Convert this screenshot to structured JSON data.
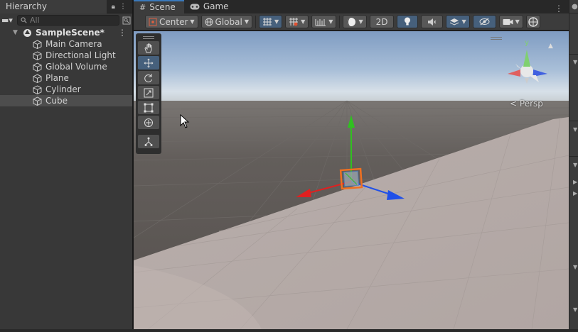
{
  "hierarchy": {
    "tab_label": "Hierarchy",
    "search_placeholder": "All",
    "scene_name": "SampleScene*",
    "items": [
      {
        "label": "Main Camera"
      },
      {
        "label": "Directional Light"
      },
      {
        "label": "Global Volume"
      },
      {
        "label": "Plane"
      },
      {
        "label": "Cylinder"
      },
      {
        "label": "Cube",
        "selected": true
      }
    ]
  },
  "scene_tabs": [
    {
      "label": "Scene",
      "icon": "grid-icon",
      "active": true
    },
    {
      "label": "Game",
      "icon": "gamepad-icon",
      "active": false
    }
  ],
  "toolbar": {
    "pivot_label": "Center",
    "space_label": "Global",
    "mode_2d_label": "2D"
  },
  "tools": [
    "hand-tool",
    "move-tool",
    "rotate-tool",
    "scale-tool",
    "rect-tool",
    "transform-tool",
    "custom-tool"
  ],
  "scene": {
    "projection_label": "Persp",
    "gizmo_axis_label": "y",
    "colors": {
      "sky_top": "#8aa6c8",
      "horizon": "#d4dde6",
      "ground": "#5a5551",
      "plane": "#b4aaa7",
      "x_axis": "#e02020",
      "y_axis": "#30c020",
      "z_axis": "#2050e8",
      "selection": "#f07020"
    }
  }
}
